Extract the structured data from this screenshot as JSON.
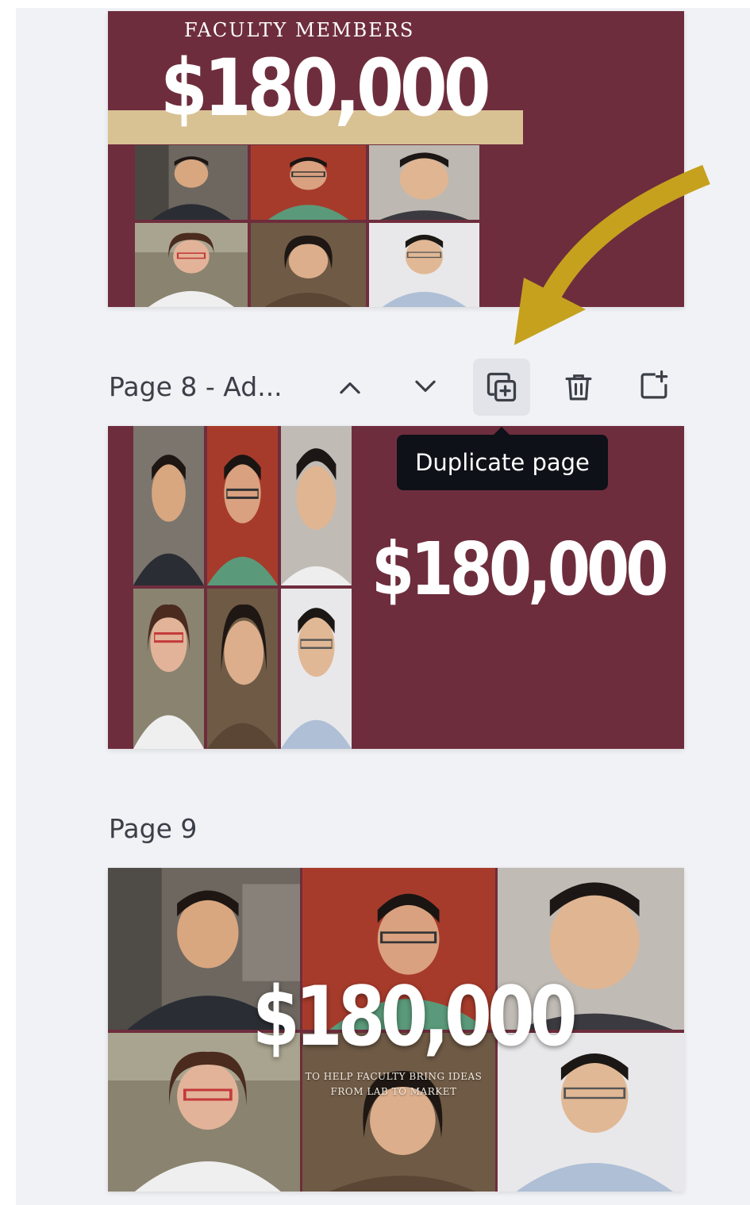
{
  "pages": [
    {
      "label": "",
      "heading": "FACULTY MEMBERS",
      "amount": "$180,000"
    },
    {
      "label": "Page 8 - Ad...",
      "amount": "$180,000"
    },
    {
      "label": "Page 9",
      "amount": "$180,000",
      "tagline_line1": "TO HELP FACULTY BRING IDEAS",
      "tagline_line2": "FROM LAB TO MARKET"
    }
  ],
  "toolbar": {
    "move_up_icon": "chevron-up-icon",
    "move_down_icon": "chevron-down-icon",
    "duplicate_icon": "duplicate-page-icon",
    "delete_icon": "trash-icon",
    "add_icon": "add-page-icon"
  },
  "tooltip": {
    "text": "Duplicate page"
  },
  "annotation": {
    "arrow_color": "#c6a11e"
  },
  "colors": {
    "maroon": "#6e2d3d",
    "gold": "#d8c193",
    "panel": "#f1f2f6"
  }
}
